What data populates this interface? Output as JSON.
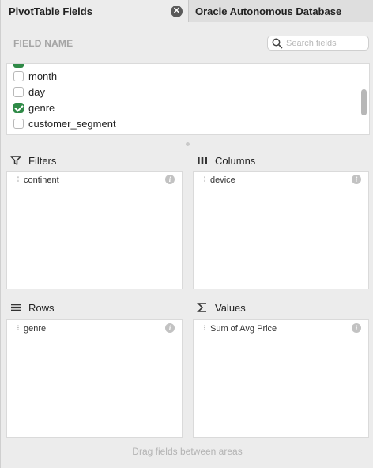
{
  "tabs": [
    {
      "label": "PivotTable Fields"
    },
    {
      "label": "Oracle Autonomous Database"
    }
  ],
  "field_list": {
    "header_label": "FIELD NAME",
    "search_placeholder": "Search fields",
    "items": [
      {
        "label": "month",
        "checked": false
      },
      {
        "label": "day",
        "checked": false
      },
      {
        "label": "genre",
        "checked": true
      },
      {
        "label": "customer_segment",
        "checked": false
      }
    ]
  },
  "areas": {
    "filters": {
      "title": "Filters",
      "icon": "filter-icon",
      "fields": [
        "continent"
      ]
    },
    "columns": {
      "title": "Columns",
      "icon": "columns-icon",
      "fields": [
        "device"
      ]
    },
    "rows": {
      "title": "Rows",
      "icon": "rows-icon",
      "fields": [
        "genre"
      ]
    },
    "values": {
      "title": "Values",
      "icon": "sigma-icon",
      "fields": [
        "Sum of Avg Price"
      ]
    }
  },
  "footer_hint": "Drag fields between areas",
  "colors": {
    "checked": "#2f8a47",
    "panel": "#ececec"
  }
}
